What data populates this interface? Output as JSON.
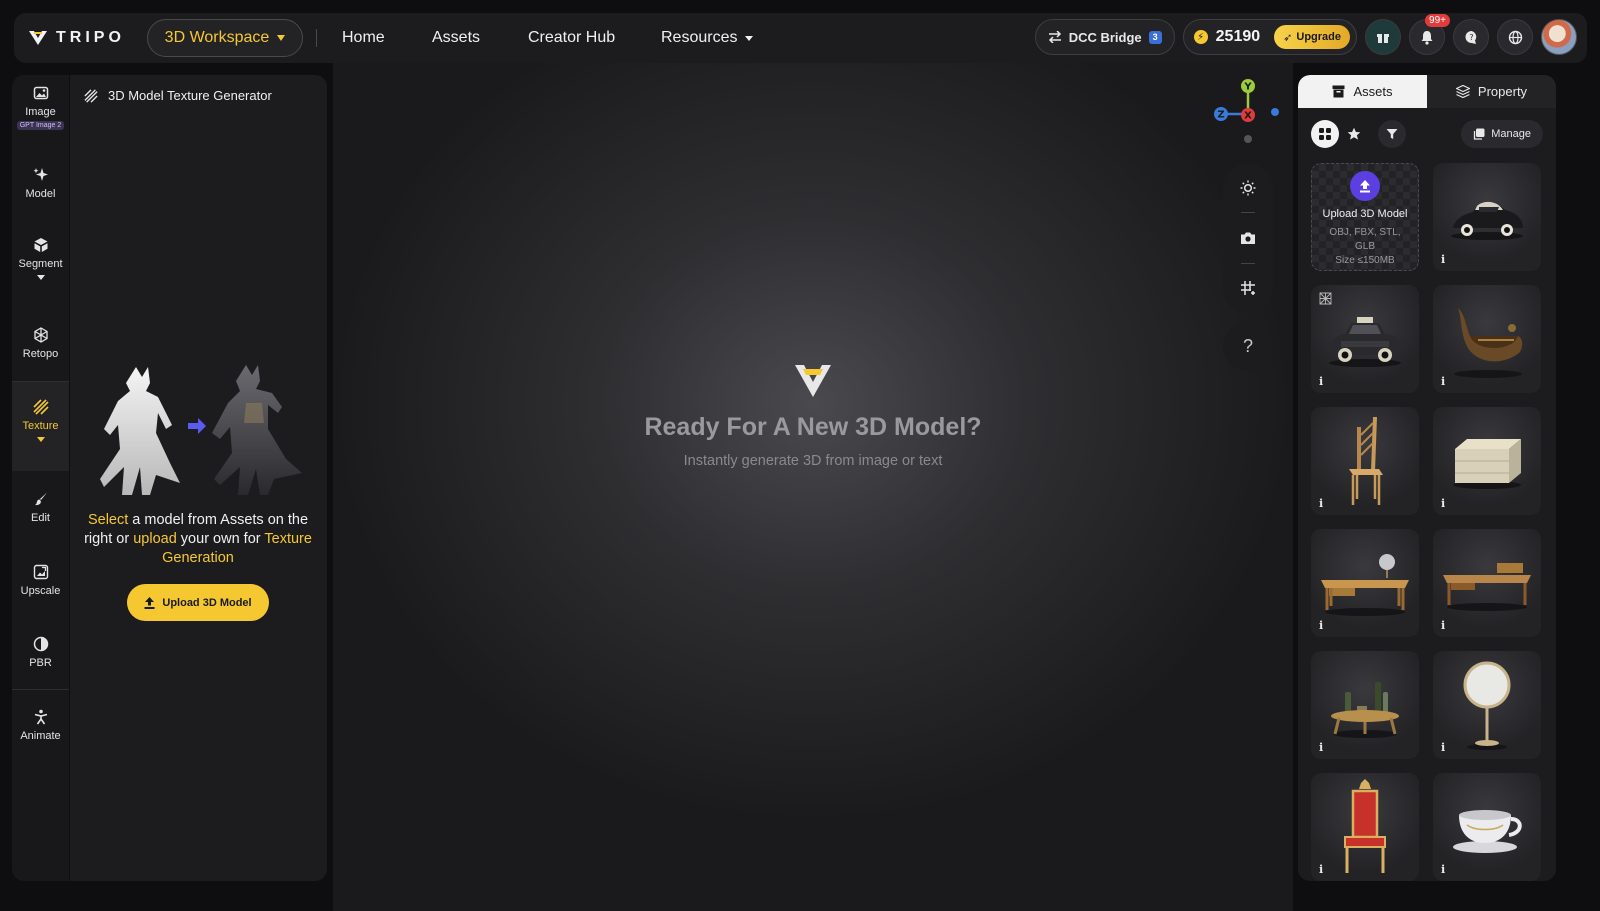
{
  "brand": {
    "name": "TRIPO"
  },
  "topbar": {
    "workspace_label": "3D Workspace",
    "nav": {
      "home": "Home",
      "assets": "Assets",
      "creator_hub": "Creator Hub",
      "resources": "Resources"
    },
    "dcc_label": "DCC Bridge",
    "dcc_badge": "3",
    "credits": "25190",
    "upgrade_label": "Upgrade",
    "notif_badge": "99+"
  },
  "rail": {
    "items": [
      {
        "label": "Image",
        "chip": "GPT Image 2"
      },
      {
        "label": "Model"
      },
      {
        "label": "Segment"
      },
      {
        "label": "Retopo"
      },
      {
        "label": "Texture"
      },
      {
        "label": "Edit"
      },
      {
        "label": "Upscale"
      },
      {
        "label": "PBR"
      },
      {
        "label": "Animate"
      }
    ]
  },
  "panel": {
    "title": "3D Model Texture Generator",
    "text": {
      "select": "Select",
      "part1": " a model from Assets on the right or ",
      "upload": "upload",
      "part2": " your own for ",
      "texgen": "Texture Generation"
    },
    "upload_label": "Upload 3D Model"
  },
  "viewport": {
    "title": "Ready For A New 3D Model?",
    "subtitle": "Instantly generate 3D from image or text",
    "help": "?",
    "gizmo": {
      "y": "Y",
      "z": "Z",
      "x": "X"
    }
  },
  "assets_panel": {
    "tab_assets": "Assets",
    "tab_property": "Property",
    "manage_label": "Manage",
    "upload_tile": {
      "title": "Upload 3D Model",
      "formats": "OBJ, FBX, STL, GLB",
      "size": "Size ≤150MB"
    },
    "info_glyph": "i"
  },
  "colors": {
    "accent": "#f5c832",
    "upload_purple": "#5b3fe0",
    "badge_red": "#e23b3b"
  }
}
